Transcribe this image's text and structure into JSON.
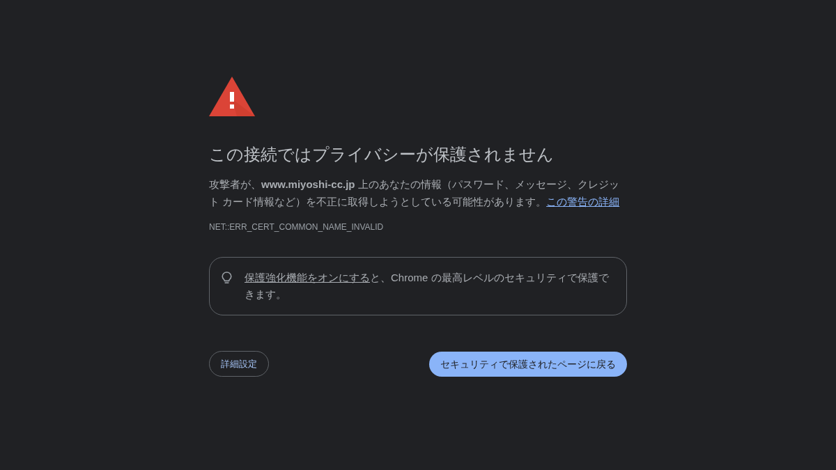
{
  "heading": "この接続ではプライバシーが保護されません",
  "message": {
    "text": "攻撃者が、**www.miyoshi-cc.jp** 上のあなたの情報（パスワード、メッセージ、クレジット カード情報など）を不正に取得しようとしている可能性があります。",
    "link": "この警告の詳細"
  },
  "error_code": "NET::ERR_CERT_COMMON_NAME_INVALID",
  "tip": {
    "link": "保護強化機能をオンにする",
    "text": "と、Chrome の最高レベルのセキュリティで保護できます。"
  },
  "buttons": [
    {
      "label": "詳細設定",
      "kind": "secondary"
    },
    {
      "label": "セキュリティで保護されたページに戻る",
      "kind": "primary"
    }
  ]
}
